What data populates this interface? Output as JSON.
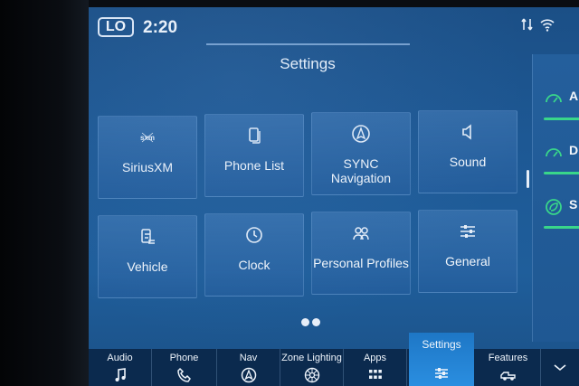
{
  "status": {
    "temp": "LO",
    "time": "2:20",
    "icons": [
      "signal-icon",
      "wifi-icon"
    ]
  },
  "page": {
    "title": "Settings"
  },
  "tiles": [
    {
      "label": "SiriusXM",
      "icon": "siriusxm-icon"
    },
    {
      "label": "Phone List",
      "icon": "phone-list-icon"
    },
    {
      "label": "SYNC Navigation",
      "icon": "navigation-icon"
    },
    {
      "label": "Sound",
      "icon": "speaker-icon"
    },
    {
      "label": "Vehicle",
      "icon": "vehicle-settings-icon"
    },
    {
      "label": "Clock",
      "icon": "clock-icon"
    },
    {
      "label": "Personal Profiles",
      "icon": "profiles-icon"
    },
    {
      "label": "General",
      "icon": "sliders-icon"
    }
  ],
  "pager": {
    "pages": 2,
    "current": 1
  },
  "side_panel": {
    "items": [
      {
        "label": "A",
        "icon": "gauge-icon"
      },
      {
        "label": "D",
        "icon": "gauge-icon"
      },
      {
        "label": "S",
        "icon": "leaf-icon"
      }
    ],
    "accent": "#39d68a"
  },
  "bottom_nav": {
    "items": [
      {
        "label": "Audio",
        "icon": "music-note-icon"
      },
      {
        "label": "Phone",
        "icon": "phone-icon"
      },
      {
        "label": "Nav",
        "icon": "navigation-icon"
      },
      {
        "label": "Zone Lighting",
        "icon": "zone-lighting-icon"
      },
      {
        "label": "Apps",
        "icon": "apps-grid-icon"
      },
      {
        "label": "Settings",
        "icon": "sliders-icon",
        "active": true
      },
      {
        "label": "Features",
        "icon": "truck-icon"
      },
      {
        "label": "",
        "icon": "chevron-down-icon"
      }
    ],
    "active_color": "#2a8ee0"
  },
  "colors": {
    "screen": "#1d5894",
    "nav": "#0b2a4e"
  }
}
